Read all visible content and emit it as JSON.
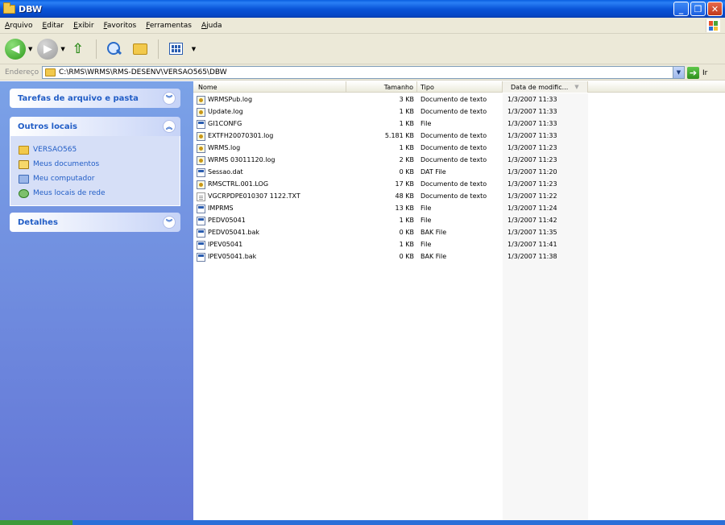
{
  "window": {
    "title": "DBW"
  },
  "menu": [
    "Arquivo",
    "Editar",
    "Exibir",
    "Favoritos",
    "Ferramentas",
    "Ajuda"
  ],
  "address": {
    "label": "Endereço",
    "path": "C:\\RMS\\WRMS\\RMS-DESENV\\VERSAO565\\DBW",
    "go_label": "Ir"
  },
  "sidebar": {
    "tasks_title": "Tarefas de arquivo e pasta",
    "places_title": "Outros locais",
    "places": [
      "VERSAO565",
      "Meus documentos",
      "Meu computador",
      "Meus locais de rede"
    ],
    "details_title": "Detalhes"
  },
  "columns": {
    "name": "Nome",
    "size": "Tamanho",
    "type": "Tipo",
    "date": "Data de modific..."
  },
  "files": [
    {
      "icon": "log",
      "name": "WRMSPub.log",
      "size": "3 KB",
      "type": "Documento de texto",
      "date": "1/3/2007 11:33"
    },
    {
      "icon": "log",
      "name": "Update.log",
      "size": "1 KB",
      "type": "Documento de texto",
      "date": "1/3/2007 11:33"
    },
    {
      "icon": "file",
      "name": "GI1CONFG",
      "size": "1 KB",
      "type": "File",
      "date": "1/3/2007 11:33"
    },
    {
      "icon": "log",
      "name": "EXTFH20070301.log",
      "size": "5.181 KB",
      "type": "Documento de texto",
      "date": "1/3/2007 11:33"
    },
    {
      "icon": "log",
      "name": "WRMS.log",
      "size": "1 KB",
      "type": "Documento de texto",
      "date": "1/3/2007 11:23"
    },
    {
      "icon": "log",
      "name": "WRMS 03011120.log",
      "size": "2 KB",
      "type": "Documento de texto",
      "date": "1/3/2007 11:23"
    },
    {
      "icon": "file",
      "name": "Sessao.dat",
      "size": "0 KB",
      "type": "DAT File",
      "date": "1/3/2007 11:20"
    },
    {
      "icon": "log",
      "name": "RMSCTRL.001.LOG",
      "size": "17 KB",
      "type": "Documento de texto",
      "date": "1/3/2007 11:23"
    },
    {
      "icon": "txt",
      "name": "VGCRPDPE010307 1122.TXT",
      "size": "48 KB",
      "type": "Documento de texto",
      "date": "1/3/2007 11:22"
    },
    {
      "icon": "file",
      "name": "IMPRMS",
      "size": "13 KB",
      "type": "File",
      "date": "1/3/2007 11:24"
    },
    {
      "icon": "file",
      "name": "PEDV05041",
      "size": "1 KB",
      "type": "File",
      "date": "1/3/2007 11:42"
    },
    {
      "icon": "file",
      "name": "PEDV05041.bak",
      "size": "0 KB",
      "type": "BAK File",
      "date": "1/3/2007 11:35"
    },
    {
      "icon": "file",
      "name": "IPEV05041",
      "size": "1 KB",
      "type": "File",
      "date": "1/3/2007 11:41"
    },
    {
      "icon": "file",
      "name": "IPEV05041.bak",
      "size": "0 KB",
      "type": "BAK File",
      "date": "1/3/2007 11:38"
    }
  ]
}
